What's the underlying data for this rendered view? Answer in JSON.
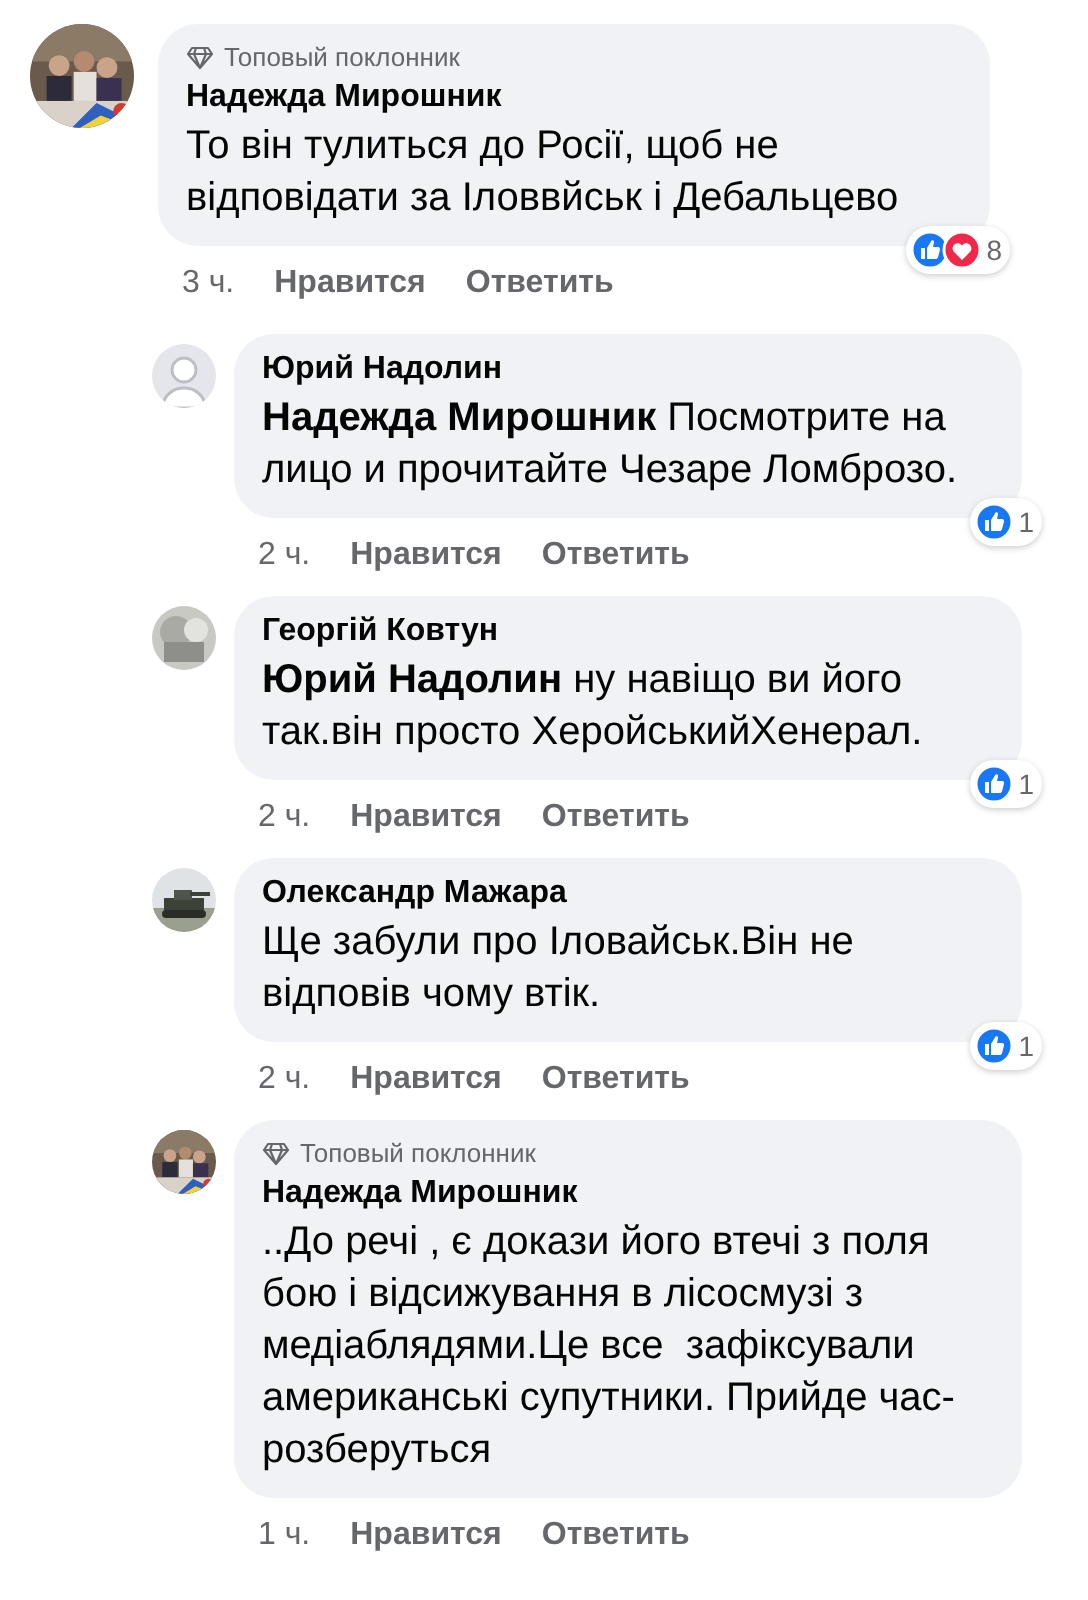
{
  "comments": [
    {
      "avatar": {
        "kind": "group"
      },
      "badge": "Топовый поклонник",
      "author": "Надежда Мирошник",
      "text": "То він тулиться до Росії, щоб не відповідати за Іловвйськ і Дебальцево",
      "time": "3 ч.",
      "like": "Нравится",
      "reply": "Ответить",
      "reactions": [
        {
          "kind": "like"
        },
        {
          "kind": "love"
        }
      ],
      "reaction_count": "8",
      "replies": [
        {
          "avatar": {
            "kind": "silhouette"
          },
          "author": "Юрий Надолин",
          "text": "**Надежда Мирошник** Посмотрите на лицо и прочитайте Чезаре Ломброзо.",
          "time": "2 ч.",
          "like": "Нравится",
          "reply": "Ответить",
          "reactions": [
            {
              "kind": "like"
            }
          ],
          "reaction_count": "1"
        },
        {
          "avatar": {
            "kind": "grey"
          },
          "author": "Георгій Ковтун",
          "text": "**Юрий Надолин** ну навіщо ви його так.він просто ХеройськийХенерал.",
          "time": "2 ч.",
          "like": "Нравится",
          "reply": "Ответить",
          "reactions": [
            {
              "kind": "like"
            }
          ],
          "reaction_count": "1"
        },
        {
          "avatar": {
            "kind": "vehicle"
          },
          "author": "Олександр Мажара",
          "text": "Ще забули про Іловайськ.Він не відповів чому втік.",
          "time": "2 ч.",
          "like": "Нравится",
          "reply": "Ответить",
          "reactions": [
            {
              "kind": "like"
            }
          ],
          "reaction_count": "1"
        },
        {
          "avatar": {
            "kind": "group"
          },
          "badge": "Топовый поклонник",
          "author": "Надежда Мирошник",
          "text": "..До речі , є докази його втечі з поля бою і відсижування в лісосмузі з медіаблядями.Це все  зафіксували американські супутники. Прийде час- розберуться",
          "time": "1 ч.",
          "like": "Нравится",
          "reply": "Ответить"
        }
      ]
    }
  ]
}
